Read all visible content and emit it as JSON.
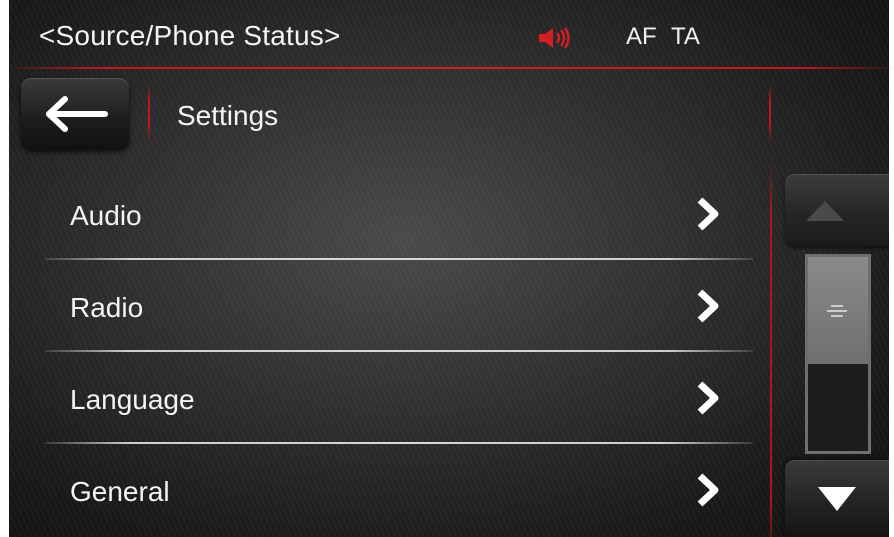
{
  "status_bar": {
    "title": "<Source/Phone Status>",
    "speaker_icon": "speaker-muted-icon",
    "flags": [
      "AF",
      "TA"
    ],
    "accent_color": "#c4161c"
  },
  "header": {
    "back_icon": "arrow-left-icon",
    "title": "Settings"
  },
  "menu": {
    "items": [
      {
        "label": "Audio",
        "icon": "chevron-right-icon"
      },
      {
        "label": "Radio",
        "icon": "chevron-right-icon"
      },
      {
        "label": "Language",
        "icon": "chevron-right-icon"
      },
      {
        "label": "General",
        "icon": "chevron-right-icon"
      }
    ]
  },
  "scrollbar": {
    "up_icon": "triangle-up-icon",
    "down_icon": "triangle-down-icon",
    "thumb_icon": "grip-lines-icon",
    "visible_fraction": 0.55,
    "position_fraction": 0.0
  },
  "colors": {
    "background": "#2a2a2a",
    "text": "#f4f4f4",
    "accent_red": "#c4161c",
    "separator": "#d8d8d8"
  }
}
